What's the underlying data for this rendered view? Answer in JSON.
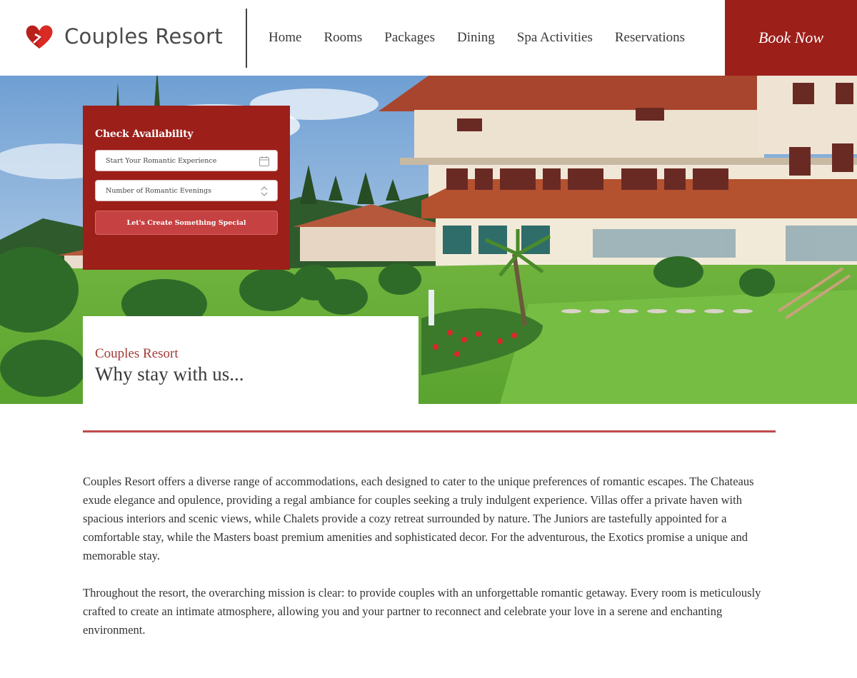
{
  "brand": {
    "name": "Couples Resort",
    "logo_icon": "heart-icon",
    "accent": "#9c1f1a"
  },
  "nav": {
    "items": [
      {
        "label": "Home"
      },
      {
        "label": "Rooms"
      },
      {
        "label": "Packages"
      },
      {
        "label": "Dining"
      },
      {
        "label": "Spa Activities"
      },
      {
        "label": "Reservations"
      }
    ],
    "cta": "Book Now"
  },
  "booking": {
    "title": "Check Availability",
    "date_field": {
      "placeholder": "Start Your Romantic Experience",
      "icon": "calendar-icon"
    },
    "nights_field": {
      "placeholder": "Number of Romantic Evenings",
      "icon": "stepper-icon"
    },
    "submit_label": "Let's Create Something Special"
  },
  "intro": {
    "kicker": "Couples Resort",
    "title": "Why stay with us..."
  },
  "body": {
    "paragraphs": [
      "Couples Resort offers a diverse range of accommodations, each designed to cater to the unique preferences of romantic escapes. The Chateaus exude elegance and opulence, providing a regal ambiance for couples seeking a truly indulgent experience. Villas offer a private haven with spacious interiors and scenic views, while Chalets provide a cozy retreat surrounded by nature. The Juniors are tastefully appointed for a comfortable stay, while the Masters boast premium amenities and sophisticated decor. For the adventurous, the Exotics promise a unique and memorable stay.",
      "Throughout the resort, the overarching mission is clear: to provide couples with an unforgettable romantic getaway. Every room is meticulously crafted to create an intimate atmosphere, allowing you and your partner to reconnect and celebrate your love in a serene and enchanting environment."
    ]
  }
}
